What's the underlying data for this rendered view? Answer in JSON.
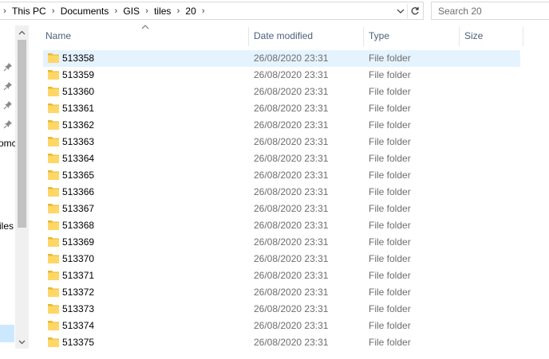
{
  "address_bar": {
    "crumbs": [
      "This PC",
      "Documents",
      "GIS",
      "tiles",
      "20"
    ]
  },
  "search": {
    "placeholder": "Search 20"
  },
  "nav_pane": {
    "partial_labels": [
      "omc",
      "iles"
    ]
  },
  "columns": {
    "name": "Name",
    "date": "Date modified",
    "type": "Type",
    "size": "Size"
  },
  "files": [
    {
      "name": "513358",
      "date": "26/08/2020 23:31",
      "type": "File folder"
    },
    {
      "name": "513359",
      "date": "26/08/2020 23:31",
      "type": "File folder"
    },
    {
      "name": "513360",
      "date": "26/08/2020 23:31",
      "type": "File folder"
    },
    {
      "name": "513361",
      "date": "26/08/2020 23:31",
      "type": "File folder"
    },
    {
      "name": "513362",
      "date": "26/08/2020 23:31",
      "type": "File folder"
    },
    {
      "name": "513363",
      "date": "26/08/2020 23:31",
      "type": "File folder"
    },
    {
      "name": "513364",
      "date": "26/08/2020 23:31",
      "type": "File folder"
    },
    {
      "name": "513365",
      "date": "26/08/2020 23:31",
      "type": "File folder"
    },
    {
      "name": "513366",
      "date": "26/08/2020 23:31",
      "type": "File folder"
    },
    {
      "name": "513367",
      "date": "26/08/2020 23:31",
      "type": "File folder"
    },
    {
      "name": "513368",
      "date": "26/08/2020 23:31",
      "type": "File folder"
    },
    {
      "name": "513369",
      "date": "26/08/2020 23:31",
      "type": "File folder"
    },
    {
      "name": "513370",
      "date": "26/08/2020 23:31",
      "type": "File folder"
    },
    {
      "name": "513371",
      "date": "26/08/2020 23:31",
      "type": "File folder"
    },
    {
      "name": "513372",
      "date": "26/08/2020 23:31",
      "type": "File folder"
    },
    {
      "name": "513373",
      "date": "26/08/2020 23:31",
      "type": "File folder"
    },
    {
      "name": "513374",
      "date": "26/08/2020 23:31",
      "type": "File folder"
    },
    {
      "name": "513375",
      "date": "26/08/2020 23:31",
      "type": "File folder"
    }
  ],
  "selected_index": 0,
  "colors": {
    "folder": "#ffd766",
    "folder_dark": "#e8b930",
    "selection": "#e5f3ff",
    "header_text": "#4c607a",
    "meta_text": "#6d6d6d"
  }
}
